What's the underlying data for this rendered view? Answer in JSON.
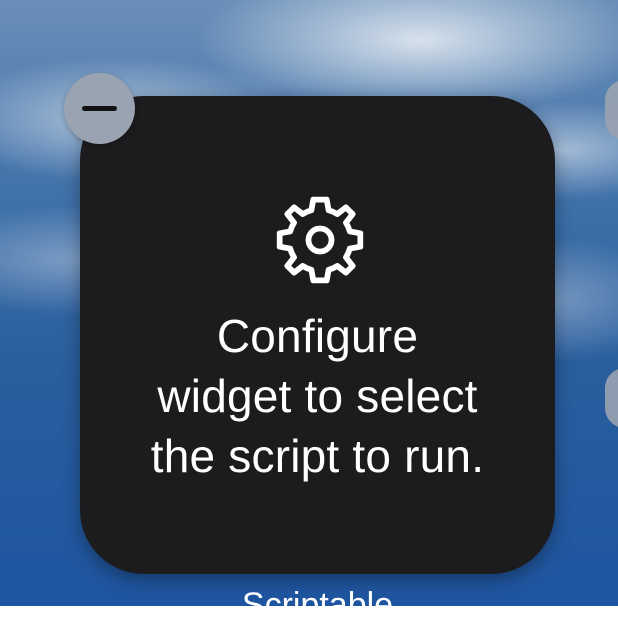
{
  "widget": {
    "icon": "gear-icon",
    "message_lines": [
      "Configure",
      "widget to select",
      "the script to run."
    ],
    "app_label": "Scriptable"
  },
  "controls": {
    "remove_icon": "minus-icon"
  },
  "colors": {
    "widget_background": "#1c1c1e",
    "text": "#ffffff",
    "remove_button": "#9aa3b1"
  }
}
